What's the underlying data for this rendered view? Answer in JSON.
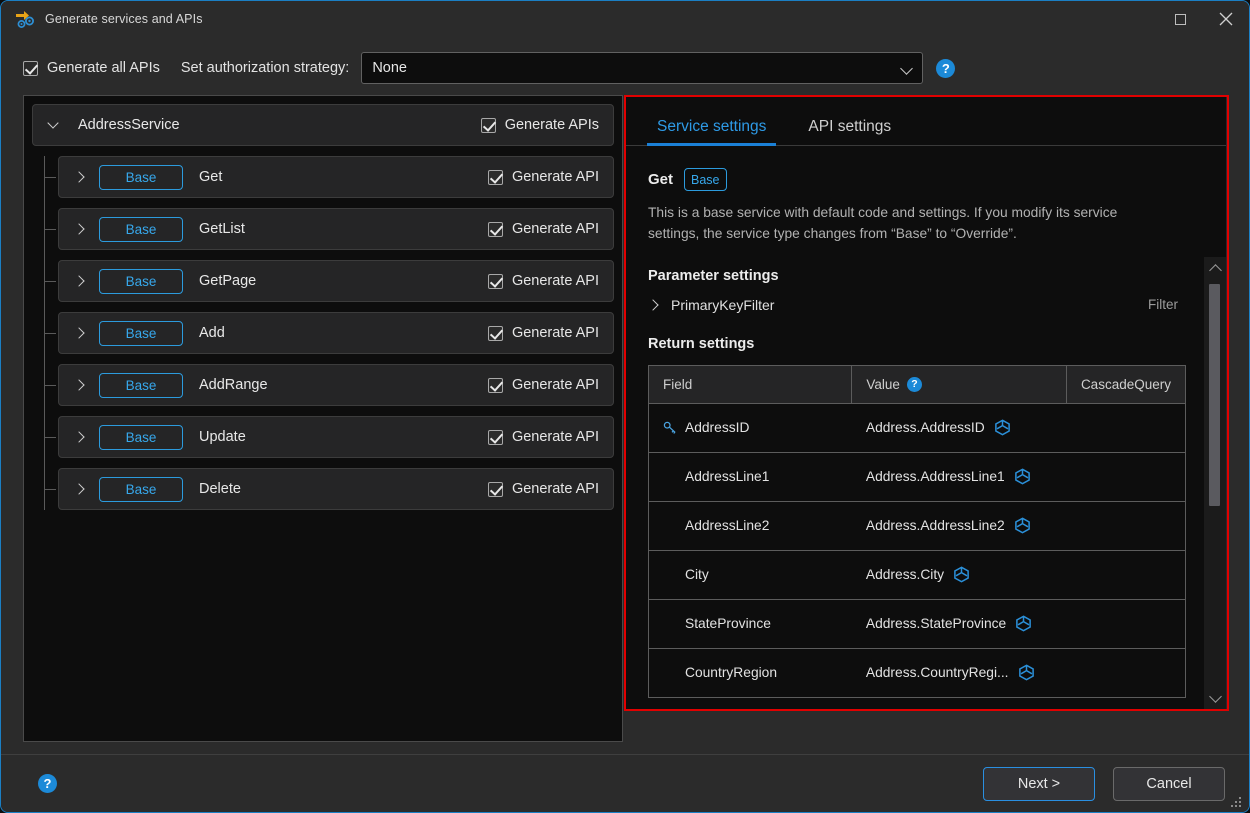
{
  "window": {
    "title": "Generate services and APIs",
    "icon": "generate-services-icon",
    "maximize_label": "Maximize",
    "close_label": "Close"
  },
  "options_bar": {
    "generate_all_label": "Generate all APIs",
    "generate_all_checked": true,
    "auth_strategy_label": "Set authorization strategy:",
    "auth_strategy_value": "None",
    "help_glyph": "?"
  },
  "tree": {
    "root": {
      "name": "AddressService",
      "expanded": true,
      "generate_label": "Generate APIs",
      "checked": true
    },
    "children": [
      {
        "badge": "Base",
        "name": "Get",
        "generate_label": "Generate API",
        "checked": true
      },
      {
        "badge": "Base",
        "name": "GetList",
        "generate_label": "Generate API",
        "checked": true
      },
      {
        "badge": "Base",
        "name": "GetPage",
        "generate_label": "Generate API",
        "checked": true
      },
      {
        "badge": "Base",
        "name": "Add",
        "generate_label": "Generate API",
        "checked": true
      },
      {
        "badge": "Base",
        "name": "AddRange",
        "generate_label": "Generate API",
        "checked": true
      },
      {
        "badge": "Base",
        "name": "Update",
        "generate_label": "Generate API",
        "checked": true
      },
      {
        "badge": "Base",
        "name": "Delete",
        "generate_label": "Generate API",
        "checked": true
      }
    ]
  },
  "detail": {
    "tabs": [
      {
        "label": "Service settings",
        "active": true
      },
      {
        "label": "API settings",
        "active": false
      }
    ],
    "header_title": "Get",
    "header_badge": "Base",
    "description": "This is a base service with default code and settings. If you modify its service settings, the service type changes from “Base” to “Override”.",
    "parameter_section_title": "Parameter settings",
    "parameter_row": {
      "name": "PrimaryKeyFilter",
      "right_label": "Filter",
      "expanded": false
    },
    "return_section_title": "Return settings",
    "table": {
      "columns": [
        "Field",
        "Value",
        "CascadeQuery"
      ],
      "value_help_glyph": "?",
      "rows": [
        {
          "field": "AddressID",
          "primary_key": true,
          "value": "Address.AddressID",
          "cascade": ""
        },
        {
          "field": "AddressLine1",
          "primary_key": false,
          "value": "Address.AddressLine1",
          "cascade": ""
        },
        {
          "field": "AddressLine2",
          "primary_key": false,
          "value": "Address.AddressLine2",
          "cascade": ""
        },
        {
          "field": "City",
          "primary_key": false,
          "value": "Address.City",
          "cascade": ""
        },
        {
          "field": "StateProvince",
          "primary_key": false,
          "value": "Address.StateProvince",
          "cascade": ""
        },
        {
          "field": "CountryRegion",
          "primary_key": false,
          "value": "Address.CountryRegi...",
          "cascade": ""
        }
      ]
    }
  },
  "footer": {
    "help_glyph": "?",
    "next_label": "Next >",
    "cancel_label": "Cancel"
  },
  "colors": {
    "accent_blue": "#2e9ae6",
    "badge_blue": "#37a8ec",
    "highlight_red": "#e10000",
    "help_blue": "#1c8ad8",
    "window_bg": "#2b2b2b",
    "panel_bg": "#0d0d0d"
  }
}
